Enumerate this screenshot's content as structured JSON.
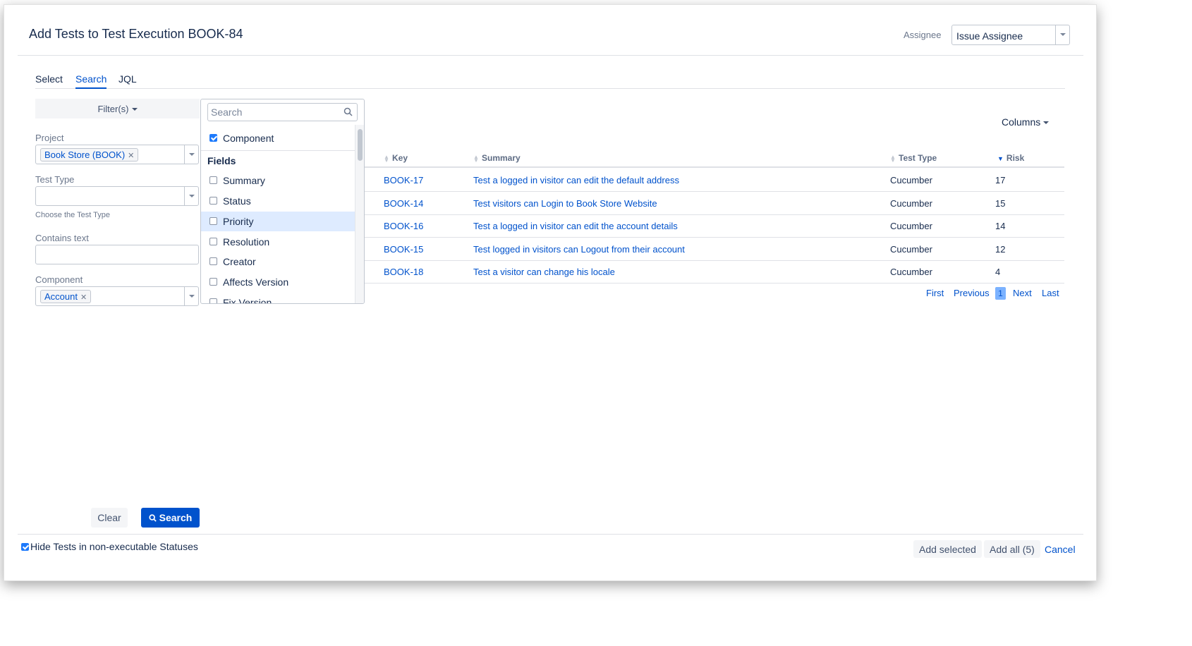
{
  "dialog": {
    "title": "Add Tests to Test Execution BOOK-84",
    "assignee_label": "Assignee",
    "assignee_value": "Issue Assignee"
  },
  "tabs": [
    {
      "label": "Select"
    },
    {
      "label": "Search",
      "active": true
    },
    {
      "label": "JQL"
    }
  ],
  "filters": {
    "toggle_label": "Filter(s)",
    "project_label": "Project",
    "project_chip": "Book Store (BOOK)",
    "test_type_label": "Test Type",
    "test_type_hint": "Choose the Test Type",
    "contains_text_label": "Contains text",
    "component_label": "Component",
    "component_chip": "Account"
  },
  "filter_dropdown": {
    "search_placeholder": "Search",
    "selected": [
      {
        "label": "Component",
        "checked": true
      }
    ],
    "fields_heading": "Fields",
    "fields": [
      {
        "label": "Summary",
        "checked": false
      },
      {
        "label": "Status",
        "checked": false
      },
      {
        "label": "Priority",
        "checked": false,
        "highlighted": true
      },
      {
        "label": "Resolution",
        "checked": false
      },
      {
        "label": "Creator",
        "checked": false
      },
      {
        "label": "Affects Version",
        "checked": false
      },
      {
        "label": "Fix Version",
        "checked": false
      }
    ]
  },
  "results": {
    "columns_button": "Columns",
    "headers": {
      "key": "Key",
      "summary": "Summary",
      "test_type": "Test Type",
      "risk": "Risk"
    },
    "rows": [
      {
        "key": "BOOK-17",
        "summary": "Test a logged in visitor can edit the default address",
        "test_type": "Cucumber",
        "risk": "17"
      },
      {
        "key": "BOOK-14",
        "summary": "Test visitors can Login to Book Store Website",
        "test_type": "Cucumber",
        "risk": "15"
      },
      {
        "key": "BOOK-16",
        "summary": "Test a logged in visitor can edit the account details",
        "test_type": "Cucumber",
        "risk": "14"
      },
      {
        "key": "BOOK-15",
        "summary": "Test logged in visitors can Logout from their account",
        "test_type": "Cucumber",
        "risk": "12"
      },
      {
        "key": "BOOK-18",
        "summary": "Test a visitor can change his locale",
        "test_type": "Cucumber",
        "risk": "4"
      }
    ],
    "pagination": {
      "first": "First",
      "previous": "Previous",
      "current": "1",
      "next": "Next",
      "last": "Last"
    }
  },
  "actions": {
    "clear": "Clear",
    "search": "Search"
  },
  "footer": {
    "hide_label": "Hide Tests in non-executable Statuses",
    "hide_checked": true,
    "add_selected": "Add selected",
    "add_all": "Add all (5)",
    "cancel": "Cancel"
  },
  "colors": {
    "accent": "#0052cc",
    "checkbox": "#1d7afc",
    "highlight": "#deebff"
  }
}
